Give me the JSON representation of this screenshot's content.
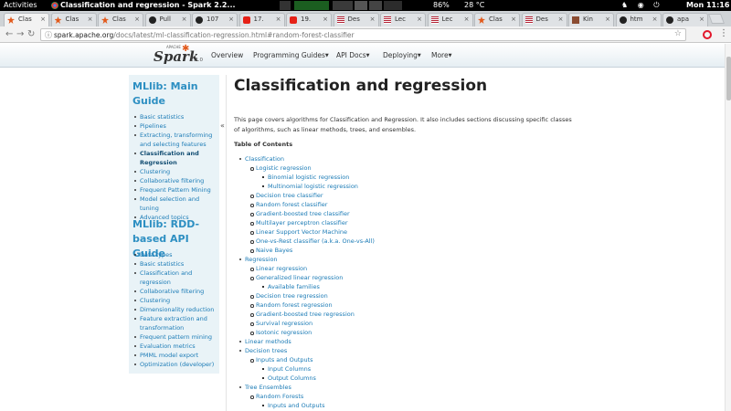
{
  "topbar": {
    "activities": "Activities",
    "window_title": "Classification and regression - Spark 2.2...",
    "battery": "86%",
    "weather": "28 °C",
    "clock": "Mon 11:16"
  },
  "tabs": [
    {
      "label": "Clas",
      "icon": "spark-icon"
    },
    {
      "label": "Clas",
      "icon": "spark-icon"
    },
    {
      "label": "Clas",
      "icon": "spark-icon"
    },
    {
      "label": "Pull",
      "icon": "github-icon"
    },
    {
      "label": "107",
      "icon": "github-icon"
    },
    {
      "label": "17.",
      "icon": "youtube-icon"
    },
    {
      "label": "19.",
      "icon": "youtube-icon"
    },
    {
      "label": "Des",
      "icon": "flag-icon"
    },
    {
      "label": "Lec",
      "icon": "flag-icon"
    },
    {
      "label": "Lec",
      "icon": "flag-icon"
    },
    {
      "label": "Clas",
      "icon": "spark-icon"
    },
    {
      "label": "Des",
      "icon": "flag-icon"
    },
    {
      "label": "Kin",
      "icon": "kindle-icon"
    },
    {
      "label": "htm",
      "icon": "github-icon"
    },
    {
      "label": "apa",
      "icon": "github-icon"
    }
  ],
  "address_bar": {
    "url_host": "spark.apache.org",
    "url_path": "/docs/latest/ml-classification-regression.html#random-forest-classifier"
  },
  "site_nav": {
    "version": "2.2.0",
    "apache_label": "APACHE",
    "brand": "Spark",
    "items": [
      "Overview",
      "Programming Guides",
      "API Docs",
      "Deploying",
      "More"
    ]
  },
  "sidebar": {
    "heading1": "MLlib: Main Guide",
    "main_items": [
      "Basic statistics",
      "Pipelines",
      "Extracting, transforming and selecting features",
      "Classification and Regression",
      "Clustering",
      "Collaborative filtering",
      "Frequent Pattern Mining",
      "Model selection and tuning",
      "Advanced topics"
    ],
    "heading2": "MLlib: RDD-based API Guide",
    "rdd_items": [
      "Data types",
      "Basic statistics",
      "Classification and regression",
      "Collaborative filtering",
      "Clustering",
      "Dimensionality reduction",
      "Feature extraction and transformation",
      "Frequent pattern mining",
      "Evaluation metrics",
      "PMML model export",
      "Optimization (developer)"
    ],
    "collapse": "«"
  },
  "content": {
    "title": "Classification and regression",
    "intro": "This page covers algorithms for Classification and Regression. It also includes sections discussing specific classes of algorithms, such as linear methods, trees, and ensembles.",
    "toc_title": "Table of Contents",
    "toc": [
      {
        "level": 1,
        "text": "Classification"
      },
      {
        "level": 2,
        "text": "Logistic regression"
      },
      {
        "level": 3,
        "text": "Binomial logistic regression"
      },
      {
        "level": 3,
        "text": "Multinomial logistic regression"
      },
      {
        "level": 2,
        "text": "Decision tree classifier"
      },
      {
        "level": 2,
        "text": "Random forest classifier"
      },
      {
        "level": 2,
        "text": "Gradient-boosted tree classifier"
      },
      {
        "level": 2,
        "text": "Multilayer perceptron classifier"
      },
      {
        "level": 2,
        "text": "Linear Support Vector Machine"
      },
      {
        "level": 2,
        "text": "One-vs-Rest classifier (a.k.a. One-vs-All)"
      },
      {
        "level": 2,
        "text": "Naive Bayes"
      },
      {
        "level": 1,
        "text": "Regression"
      },
      {
        "level": 2,
        "text": "Linear regression"
      },
      {
        "level": 2,
        "text": "Generalized linear regression"
      },
      {
        "level": 3,
        "text": "Available families"
      },
      {
        "level": 2,
        "text": "Decision tree regression"
      },
      {
        "level": 2,
        "text": "Random forest regression"
      },
      {
        "level": 2,
        "text": "Gradient-boosted tree regression"
      },
      {
        "level": 2,
        "text": "Survival regression"
      },
      {
        "level": 2,
        "text": "Isotonic regression"
      },
      {
        "level": 1,
        "text": "Linear methods"
      },
      {
        "level": 1,
        "text": "Decision trees"
      },
      {
        "level": 2,
        "text": "Inputs and Outputs"
      },
      {
        "level": 3,
        "text": "Input Columns"
      },
      {
        "level": 3,
        "text": "Output Columns"
      },
      {
        "level": 1,
        "text": "Tree Ensembles"
      },
      {
        "level": 2,
        "text": "Random Forests"
      },
      {
        "level": 3,
        "text": "Inputs and Outputs"
      }
    ]
  },
  "colors": {
    "link": "#1b7bb6",
    "sidebar_heading": "#2d8fc2",
    "sidebar_bg": "#e9f3f7",
    "spark_orange": "#e25a1c"
  }
}
